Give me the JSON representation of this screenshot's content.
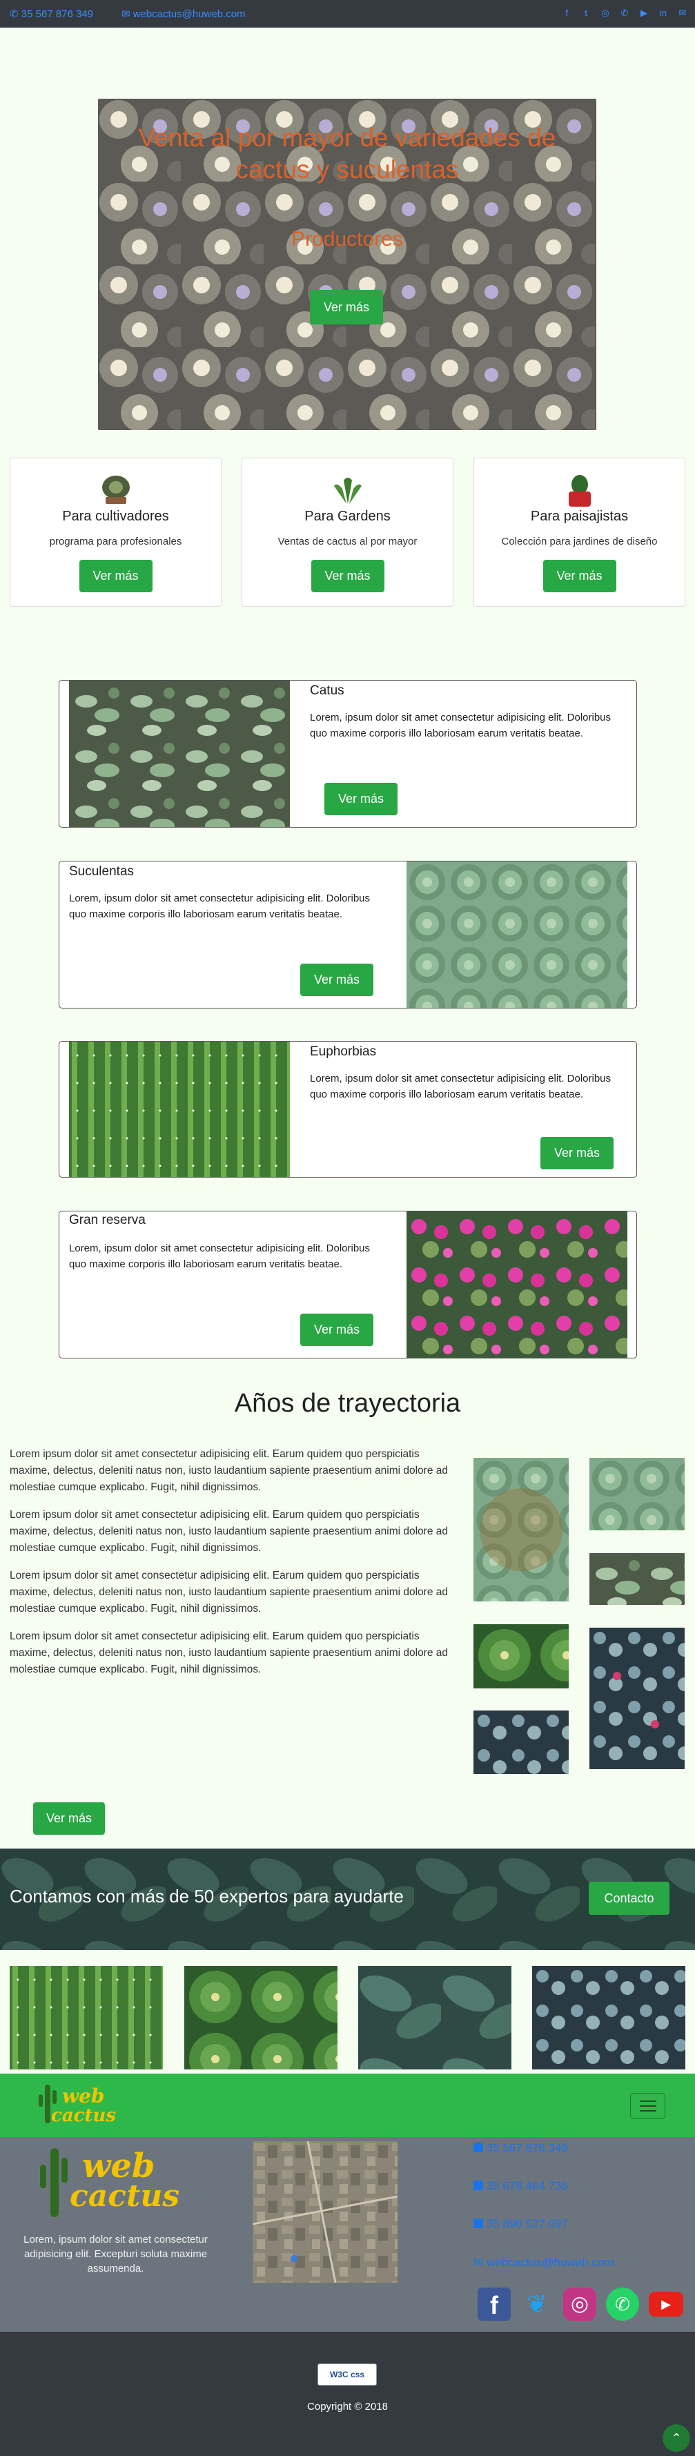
{
  "topbar": {
    "phone": "35 567 876 349",
    "email": "webcactus@huweb.com",
    "social_icons": [
      "facebook-icon",
      "twitter-icon",
      "instagram-icon",
      "whatsapp-icon",
      "youtube-icon",
      "linkedin-icon",
      "email-icon"
    ]
  },
  "hero": {
    "title": "Venta al por mayor de variedades de cactus y suculentas",
    "subtitle": "Productores",
    "button": "Ver más"
  },
  "cards": [
    {
      "title": "Para cultivadores",
      "desc": "programa para profesionales",
      "button": "Ver más",
      "icon": "cactus-pot-icon"
    },
    {
      "title": "Para Gardens",
      "desc": "Ventas de cactus al por mayor",
      "button": "Ver más",
      "icon": "succulent-icon"
    },
    {
      "title": "Para paisajistas",
      "desc": "Colección para jardines de diseño",
      "button": "Ver más",
      "icon": "red-pot-cactus-icon"
    }
  ],
  "products": [
    {
      "title": "Catus",
      "text": "Lorem, ipsum dolor sit amet consectetur adipisicing elit. Doloribus quo maxime corporis illo laboriosam earum veritatis beatae.",
      "button": "Ver más"
    },
    {
      "title": "Suculentas",
      "text": "Lorem, ipsum dolor sit amet consectetur adipisicing elit. Doloribus quo maxime corporis illo laboriosam earum veritatis beatae.",
      "button": "Ver más"
    },
    {
      "title": "Euphorbias",
      "text": "Lorem, ipsum dolor sit amet consectetur adipisicing elit. Doloribus quo maxime corporis illo laboriosam earum veritatis beatae.",
      "button": "Ver más"
    },
    {
      "title": "Gran reserva",
      "text": "Lorem, ipsum dolor sit amet consectetur adipisicing elit. Doloribus quo maxime corporis illo laboriosam earum veritatis beatae.",
      "button": "Ver más"
    }
  ],
  "history": {
    "title": "Años de trayectoria",
    "paragraphs": [
      "Lorem ipsum dolor sit amet consectetur adipisicing elit. Earum quidem quo perspiciatis maxime, delectus, deleniti natus non, iusto laudantium sapiente praesentium animi dolore ad molestiae cumque explicabo. Fugit, nihil dignissimos.",
      "Lorem ipsum dolor sit amet consectetur adipisicing elit. Earum quidem quo perspiciatis maxime, delectus, deleniti natus non, iusto laudantium sapiente praesentium animi dolore ad molestiae cumque explicabo. Fugit, nihil dignissimos.",
      "Lorem ipsum dolor sit amet consectetur adipisicing elit. Earum quidem quo perspiciatis maxime, delectus, deleniti natus non, iusto laudantium sapiente praesentium animi dolore ad molestiae cumque explicabo. Fugit, nihil dignissimos.",
      "Lorem ipsum dolor sit amet consectetur adipisicing elit. Earum quidem quo perspiciatis maxime, delectus, deleniti natus non, iusto laudantium sapiente praesentium animi dolore ad molestiae cumque explicabo. Fugit, nihil dignissimos."
    ],
    "button": "Ver más"
  },
  "experts": {
    "text": "Contamos con más de 50 expertos para ayudarte",
    "button": "Contacto"
  },
  "navbar": {
    "logo_line1": "web",
    "logo_line2": "cactus",
    "toggler_icon": "hamburger-icon"
  },
  "footer": {
    "logo_line1": "web",
    "logo_line2": "cactus",
    "about": "Lorem, ipsum dolor sit amet consectetur adipisicing elit. Excepturi soluta maxime assumenda.",
    "phones": [
      "35 567 876 349",
      "35 678 464 736",
      "35 890 527 097"
    ],
    "email": "webcactus@huweb.com",
    "social": [
      "facebook-icon",
      "twitter-icon",
      "instagram-icon",
      "whatsapp-icon",
      "youtube-icon"
    ]
  },
  "bottom": {
    "badge": "W3C css",
    "copyright": "Copyright © 2018"
  },
  "colors": {
    "primary_green": "#28a745",
    "hero_text": "#d9622b",
    "link_blue": "#1a73e8",
    "dark": "#343a40",
    "footer_gray": "#6c757d",
    "page_bg": "#f6fdf1"
  }
}
